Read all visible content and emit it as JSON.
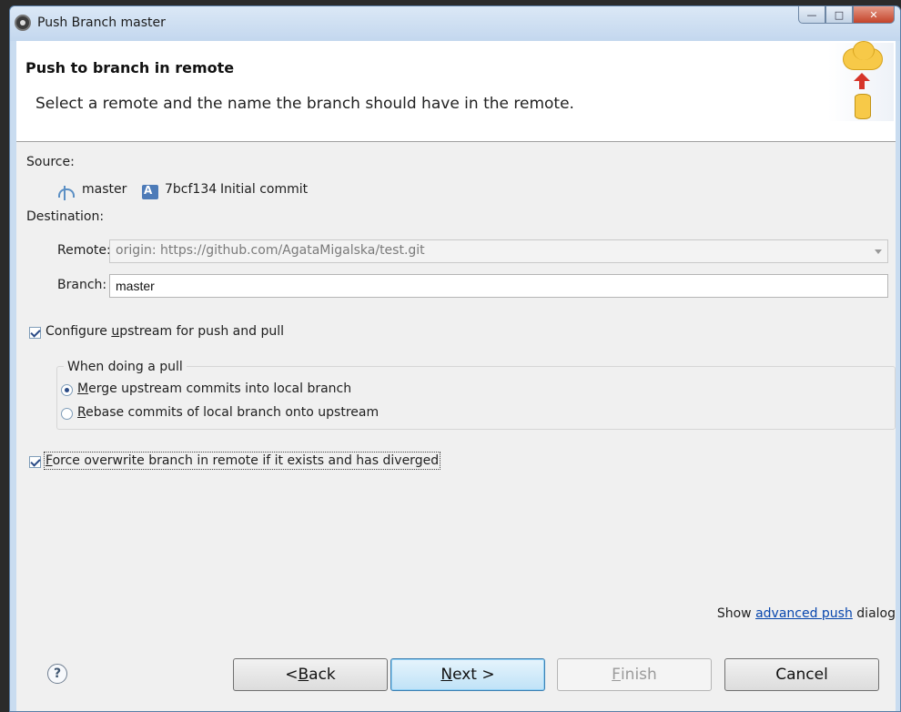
{
  "window": {
    "title": "Push Branch master"
  },
  "header": {
    "title": "Push to branch in remote",
    "description": "Select a remote and the name the branch should have in the remote.",
    "graphic_icon": "cloud-upload-icon"
  },
  "source": {
    "label": "Source:",
    "branch": "master",
    "commit_id": "7bcf134",
    "commit_message": "Initial commit"
  },
  "destination": {
    "label": "Destination:",
    "remote_label": "Remote:",
    "remote_value": "origin: https://github.com/AgataMigalska/test.git",
    "branch_label": "Branch:",
    "branch_value": "master"
  },
  "upstream": {
    "pre": "Configure ",
    "mnemonic": "u",
    "post": "pstream for push and pull",
    "checked": true
  },
  "pull_group": {
    "title": "When doing a pull",
    "merge_mnemonic": "M",
    "merge_rest": "erge upstream commits into local branch",
    "merge_selected": true,
    "rebase_mnemonic": "R",
    "rebase_rest": "ebase commits of local branch onto upstream",
    "rebase_selected": false
  },
  "force": {
    "mnemonic": "F",
    "rest": "orce overwrite branch in remote if it exists and has diverged",
    "checked": true
  },
  "advanced": {
    "pre": "Show ",
    "link": "advanced push",
    "post": " dialog"
  },
  "buttons": {
    "back_pre": "< ",
    "back_mnemonic": "B",
    "back_rest": "ack",
    "next_mnemonic": "N",
    "next_rest": "ext >",
    "finish_mnemonic": "F",
    "finish_rest": "inish",
    "cancel": "Cancel",
    "help": "?"
  },
  "colors": {
    "accent": "#3c7fb1",
    "link": "#0645ad"
  }
}
